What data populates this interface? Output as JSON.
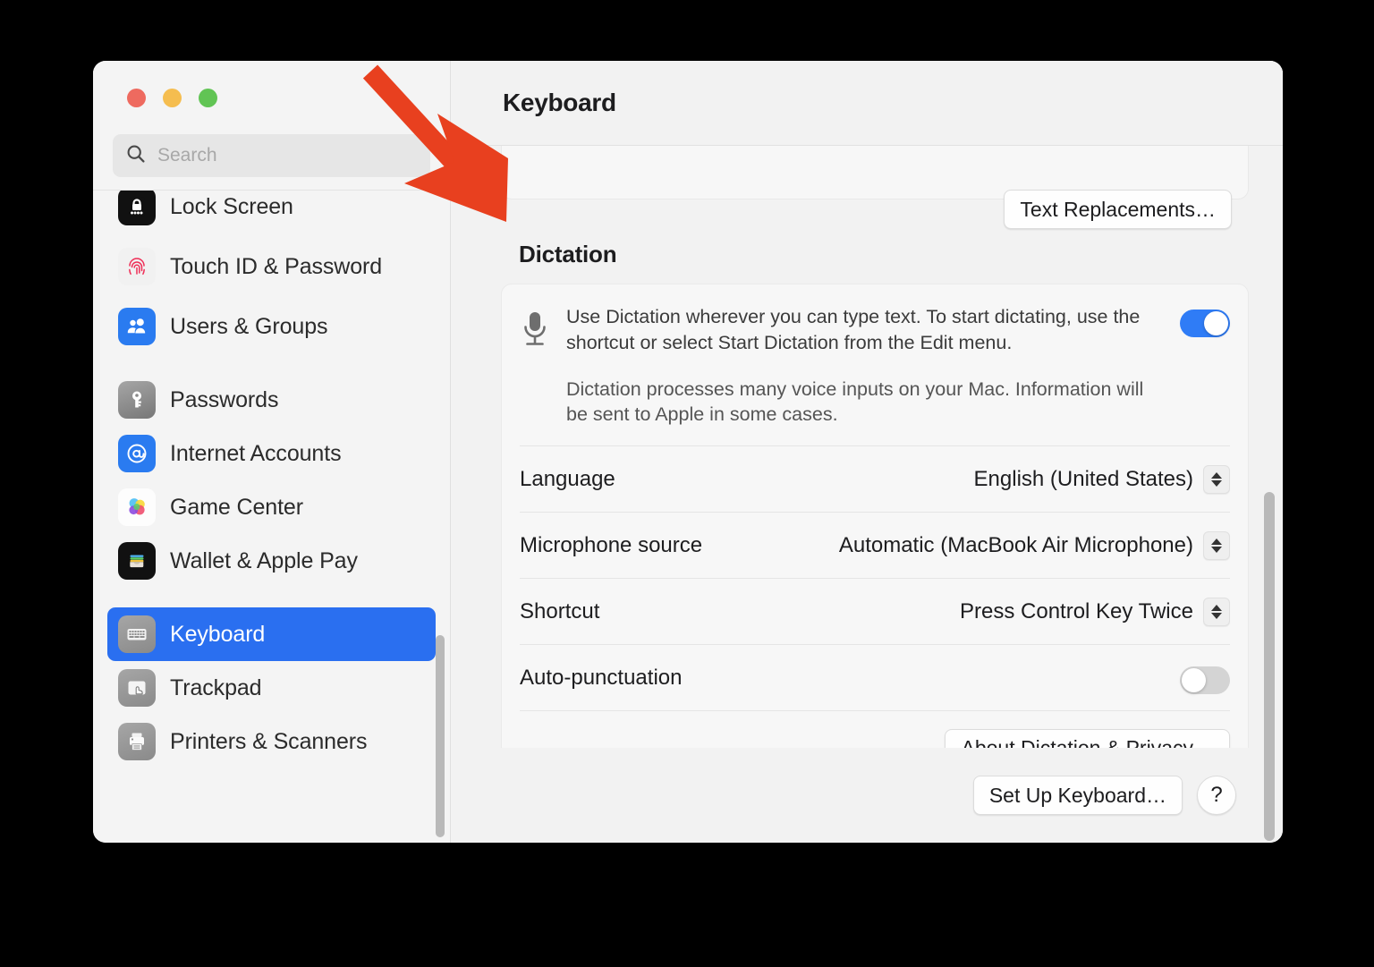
{
  "window": {
    "title": "Keyboard",
    "traffic_lights": [
      {
        "name": "close",
        "color": "#ee6a5f"
      },
      {
        "name": "minimize",
        "color": "#f5bd4f"
      },
      {
        "name": "zoom",
        "color": "#61c454"
      }
    ]
  },
  "sidebar": {
    "search": {
      "value": "",
      "placeholder": "Search",
      "icon": "search-icon"
    },
    "items": [
      {
        "label": "Lock Screen",
        "icon": "lock-screen-icon",
        "selected": false,
        "gap_after": false,
        "two_line": false
      },
      {
        "label": "Touch ID & Password",
        "icon": "touch-id-icon",
        "selected": false,
        "gap_after": false,
        "two_line": true
      },
      {
        "label": "Users & Groups",
        "icon": "users-groups-icon",
        "selected": false,
        "gap_after": true,
        "two_line": false
      },
      {
        "label": "Passwords",
        "icon": "passwords-key-icon",
        "selected": false,
        "gap_after": false,
        "two_line": false
      },
      {
        "label": "Internet Accounts",
        "icon": "internet-accounts-icon",
        "selected": false,
        "gap_after": false,
        "two_line": false
      },
      {
        "label": "Game Center",
        "icon": "game-center-icon",
        "selected": false,
        "gap_after": false,
        "two_line": false
      },
      {
        "label": "Wallet & Apple Pay",
        "icon": "wallet-icon",
        "selected": false,
        "gap_after": true,
        "two_line": false
      },
      {
        "label": "Keyboard",
        "icon": "keyboard-icon",
        "selected": true,
        "gap_after": false,
        "two_line": false
      },
      {
        "label": "Trackpad",
        "icon": "trackpad-icon",
        "selected": false,
        "gap_after": false,
        "two_line": false
      },
      {
        "label": "Printers & Scanners",
        "icon": "printers-scanners-icon",
        "selected": false,
        "gap_after": false,
        "two_line": false
      }
    ]
  },
  "main": {
    "text_replacements_button": "Text Replacements…",
    "dictation": {
      "section_title": "Dictation",
      "icon": "microphone-icon",
      "description_line1": "Use Dictation wherever you can type text. To start dictating, use the shortcut or select Start Dictation from the Edit menu.",
      "description_line2": "Dictation processes many voice inputs on your Mac. Information will be sent to Apple in some cases.",
      "enabled_toggle": {
        "name": "dictation-toggle",
        "state": "on"
      },
      "rows": [
        {
          "label": "Language",
          "value": "English (United States)",
          "control": "stepper"
        },
        {
          "label": "Microphone source",
          "value": "Automatic (MacBook Air Microphone)",
          "control": "stepper"
        },
        {
          "label": "Shortcut",
          "value": "Press Control Key Twice",
          "control": "stepper"
        },
        {
          "label": "Auto-punctuation",
          "value": "",
          "control": "toggle-off"
        }
      ],
      "about_button": "About Dictation & Privacy…"
    },
    "footer": {
      "setup_button": "Set Up Keyboard…",
      "help_button": "?"
    }
  },
  "annotation": {
    "arrow": {
      "name": "red-arrow-annotation",
      "color": "#e8401f"
    }
  }
}
